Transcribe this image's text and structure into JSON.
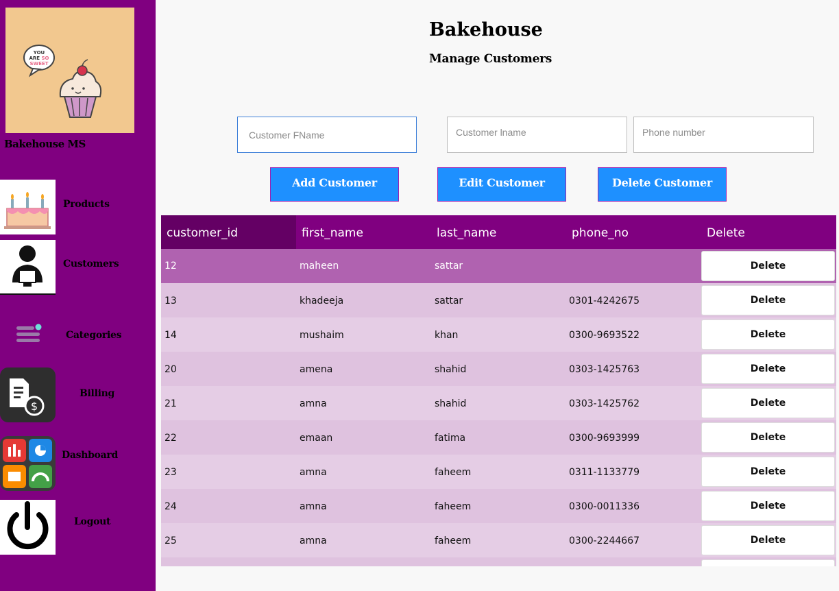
{
  "app": {
    "logo_text": "YOU ARE SO SWEET",
    "name": "Bakehouse MS"
  },
  "nav": {
    "products": "Products",
    "customers": "Customers",
    "categories": "Categories",
    "billing": "Billing",
    "dashboard": "Dashboard",
    "logout": "Logout"
  },
  "header": {
    "title": "Bakehouse",
    "subtitle": "Manage Customers"
  },
  "form": {
    "fname_placeholder": "Customer FName",
    "lname_placeholder": "Customer lname",
    "phone_placeholder": "Phone number",
    "fname_value": "",
    "lname_value": "",
    "phone_value": ""
  },
  "buttons": {
    "add": "Add Customer",
    "edit": "Edit Customer",
    "delete": "Delete Customer"
  },
  "table": {
    "columns": [
      "customer_id",
      "first_name",
      "last_name",
      "phone_no",
      "Delete"
    ],
    "delete_label": "Delete",
    "rows": [
      {
        "customer_id": "12",
        "first_name": "maheen",
        "last_name": "sattar",
        "phone_no": ""
      },
      {
        "customer_id": "13",
        "first_name": "khadeeja",
        "last_name": "sattar",
        "phone_no": "0301-4242675"
      },
      {
        "customer_id": "14",
        "first_name": "mushaim",
        "last_name": "khan",
        "phone_no": "0300-9693522"
      },
      {
        "customer_id": "20",
        "first_name": "amena",
        "last_name": "shahid",
        "phone_no": "0303-1425763"
      },
      {
        "customer_id": "21",
        "first_name": "amna",
        "last_name": "shahid",
        "phone_no": "0303-1425762"
      },
      {
        "customer_id": "22",
        "first_name": "emaan",
        "last_name": "fatima",
        "phone_no": "0300-9693999"
      },
      {
        "customer_id": "23",
        "first_name": "amna",
        "last_name": "faheem",
        "phone_no": "0311-1133779"
      },
      {
        "customer_id": "24",
        "first_name": "amna",
        "last_name": "faheem",
        "phone_no": "0300-0011336"
      },
      {
        "customer_id": "25",
        "first_name": "amna",
        "last_name": "faheem",
        "phone_no": "0300-2244667"
      }
    ],
    "selected_row": 0
  },
  "colors": {
    "sidebar": "#800080",
    "header_row": "#800080",
    "selected_row": "#b062b0",
    "button": "#1e90ff"
  }
}
